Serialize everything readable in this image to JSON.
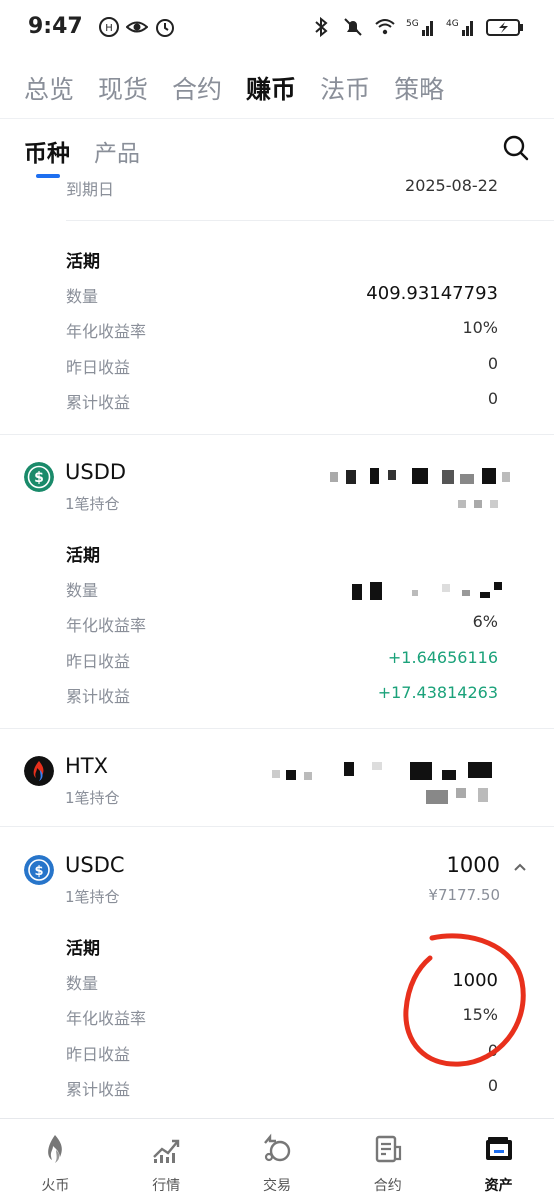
{
  "status_bar": {
    "time": "9:47",
    "net_5g": "5G",
    "net_4g": "4G"
  },
  "top_tabs": [
    {
      "label": "总览",
      "active": false
    },
    {
      "label": "现货",
      "active": false
    },
    {
      "label": "合约",
      "active": false
    },
    {
      "label": "赚币",
      "active": true
    },
    {
      "label": "法币",
      "active": false
    },
    {
      "label": "策略",
      "active": false
    }
  ],
  "sub_tabs": [
    {
      "label": "币种",
      "active": true
    },
    {
      "label": "产品",
      "active": false
    }
  ],
  "section_top": {
    "maturity_label": "到期日",
    "maturity_value": "2025-08-22",
    "flex_title": "活期",
    "qty_label": "数量",
    "qty_value": "409.93147793",
    "apr_label": "年化收益率",
    "apr_value": "10%",
    "yday_label": "昨日收益",
    "yday_value": "0",
    "total_label": "累计收益",
    "total_value": "0"
  },
  "usdd": {
    "name": "USDD",
    "positions": "1笔持仓",
    "flex_title": "活期",
    "qty_label": "数量",
    "apr_label": "年化收益率",
    "apr_value": "6%",
    "yday_label": "昨日收益",
    "yday_value": "+1.64656116",
    "total_label": "累计收益",
    "total_value": "+17.43814263"
  },
  "htx": {
    "name": "HTX",
    "positions": "1笔持仓"
  },
  "usdc": {
    "name": "USDC",
    "positions": "1笔持仓",
    "amount": "1000",
    "fiat": "¥7177.50",
    "flex_title": "活期",
    "qty_label": "数量",
    "qty_value": "1000",
    "apr_label": "年化收益率",
    "apr_value": "15%",
    "yday_label": "昨日收益",
    "yday_value": "0",
    "total_label": "累计收益",
    "total_value": "0"
  },
  "bottom_nav": [
    {
      "label": "火币",
      "icon": "flame-icon",
      "active": false
    },
    {
      "label": "行情",
      "icon": "market-chart-icon",
      "active": false
    },
    {
      "label": "交易",
      "icon": "trade-icon",
      "active": false
    },
    {
      "label": "合约",
      "icon": "contract-icon",
      "active": false
    },
    {
      "label": "资产",
      "icon": "wallet-icon",
      "active": true
    }
  ],
  "colors": {
    "accent": "#1e6ff0",
    "positive": "#1ba27a",
    "annotation": "#e8301c"
  }
}
